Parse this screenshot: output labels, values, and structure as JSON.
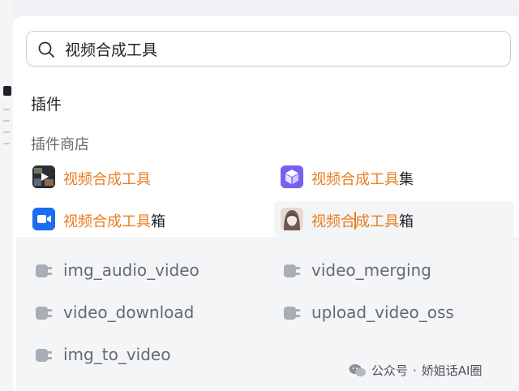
{
  "search": {
    "value": "视频合成工具",
    "placeholder": ""
  },
  "section_title": "插件",
  "store_title": "插件商店",
  "plugins": [
    {
      "highlight": "视频合成工具",
      "suffix": "",
      "icon": "video-play-icon"
    },
    {
      "highlight": "视频合成工具",
      "suffix": "集",
      "icon": "cube-icon"
    },
    {
      "highlight": "视频合成工具",
      "suffix": "箱",
      "icon": "video-camera-icon"
    },
    {
      "highlight_a": "视频合",
      "highlight_b": "成工具",
      "suffix": "箱",
      "icon": "anime-avatar-icon"
    }
  ],
  "tools": [
    {
      "label": "img_audio_video",
      "icon": "plugin-plug-icon"
    },
    {
      "label": "video_merging",
      "icon": "plugin-plug-icon"
    },
    {
      "label": "video_download",
      "icon": "plugin-plug-icon"
    },
    {
      "label": "upload_video_oss",
      "icon": "plugin-plug-icon"
    },
    {
      "label": "img_to_video",
      "icon": "plugin-plug-icon"
    }
  ],
  "watermark": {
    "part1": "公众号",
    "dot": "·",
    "part2": "娇姐话AI圈"
  },
  "colors": {
    "highlight": "#e87d1e",
    "text": "#1f2329",
    "muted": "#646a73"
  }
}
